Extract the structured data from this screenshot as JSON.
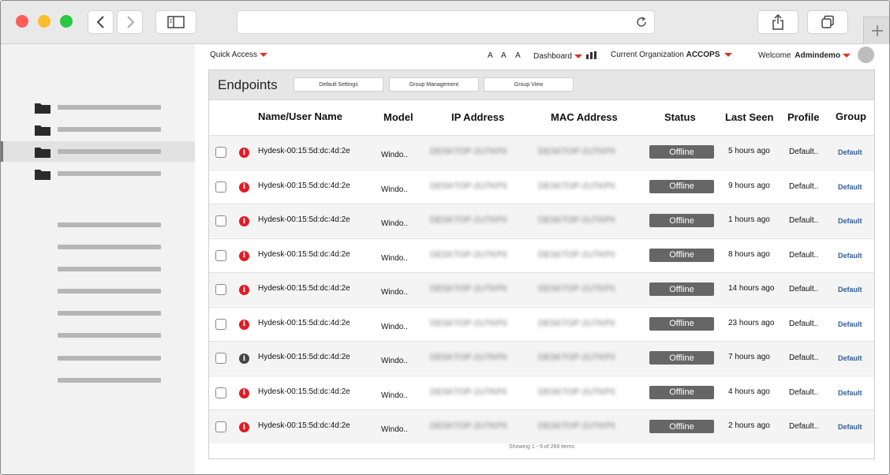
{
  "browser": {
    "icons": [
      "back-icon",
      "forward-icon",
      "sidebar-toggle-icon",
      "reload-icon",
      "share-icon",
      "tabs-icon",
      "new-tab-icon"
    ]
  },
  "topnav": {
    "quick_access": "Quick Access",
    "font_a1": "A",
    "font_a2": "A",
    "font_a3": "A",
    "dashboard": "Dashboard",
    "org_label": "Current Organization",
    "org_name": "ACCOPS",
    "welcome": "Welcome",
    "user": "Admindemo"
  },
  "panel": {
    "title": "Endpoints",
    "buttons": [
      "Default  Settings",
      "Group Management",
      "Group View"
    ],
    "columns": [
      "Name/User Name",
      "Model",
      "IP Address",
      "MAC Address",
      "Status",
      "Last Seen",
      "Profile",
      "Group"
    ],
    "rows": [
      {
        "name": "Hydesk-00:15:5d:dc:4d:2e",
        "model": "Windo..",
        "ip": "DESKTOP-2UTKPII",
        "mac": "DESKTOP-2UTKPII",
        "status": "Offline",
        "last_seen": "5 hours ago",
        "profile": "Default..",
        "group": "Default",
        "info": "red"
      },
      {
        "name": "Hydesk-00:15:5d:dc:4d:2e",
        "model": "Windo..",
        "ip": "DESKTOP-2UTKPII",
        "mac": "DESKTOP-2UTKPII",
        "status": "Offline",
        "last_seen": "9 hours ago",
        "profile": "Default..",
        "group": "Default",
        "info": "red"
      },
      {
        "name": "Hydesk-00:15:5d:dc:4d:2e",
        "model": "Windo..",
        "ip": "DESKTOP-2UTKPII",
        "mac": "DESKTOP-2UTKPII",
        "status": "Offline",
        "last_seen": "1 hours ago",
        "profile": "Default..",
        "group": "Default",
        "info": "red"
      },
      {
        "name": "Hydesk-00:15:5d:dc:4d:2e",
        "model": "Windo..",
        "ip": "DESKTOP-2UTKPII",
        "mac": "DESKTOP-2UTKPII",
        "status": "Offline",
        "last_seen": "8 hours ago",
        "profile": "Default..",
        "group": "Default",
        "info": "red"
      },
      {
        "name": "Hydesk-00:15:5d:dc:4d:2e",
        "model": "Windo..",
        "ip": "DESKTOP-2UTKPII",
        "mac": "DESKTOP-2UTKPII",
        "status": "Offline",
        "last_seen": "14 hours ago",
        "profile": "Default..",
        "group": "Default",
        "info": "red"
      },
      {
        "name": "Hydesk-00:15:5d:dc:4d:2e",
        "model": "Windo..",
        "ip": "DESKTOP-2UTKPII",
        "mac": "DESKTOP-2UTKPII",
        "status": "Offline",
        "last_seen": "23 hours ago",
        "profile": "Default..",
        "group": "Default",
        "info": "red"
      },
      {
        "name": "Hydesk-00:15:5d:dc:4d:2e",
        "model": "Windo..",
        "ip": "DESKTOP-2UTKPII",
        "mac": "DESKTOP-2UTKPII",
        "status": "Offline",
        "last_seen": "7 hours ago",
        "profile": "Default..",
        "group": "Default",
        "info": "gray"
      },
      {
        "name": "Hydesk-00:15:5d:dc:4d:2e",
        "model": "Windo..",
        "ip": "DESKTOP-2UTKPII",
        "mac": "DESKTOP-2UTKPII",
        "status": "Offline",
        "last_seen": "4 hours ago",
        "profile": "Default..",
        "group": "Default",
        "info": "red"
      },
      {
        "name": "Hydesk-00:15:5d:dc:4d:2e",
        "model": "Windo..",
        "ip": "DESKTOP-2UTKPII",
        "mac": "DESKTOP-2UTKPII",
        "status": "Offline",
        "last_seen": "2 hours ago",
        "profile": "Default..",
        "group": "Default",
        "info": "red"
      }
    ],
    "footer": "Showing 1 - 9 of 269 items"
  },
  "colors": {
    "accent_red": "#e0312a",
    "link_blue": "#2f5f9a",
    "status_gray": "#666666",
    "info_red": "#e31b23",
    "info_gray": "#444444"
  }
}
